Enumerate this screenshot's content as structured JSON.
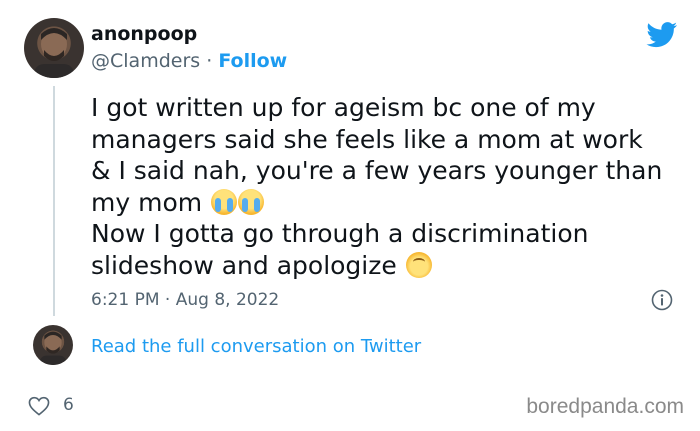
{
  "author": {
    "display_name": "anonpoop",
    "handle": "@Clamders",
    "separator": "·",
    "follow_label": "Follow"
  },
  "tweet": {
    "lines": [
      "I got written up for ageism bc one of my",
      "managers said she feels like a mom at work",
      "& I said nah, you're a few years younger than",
      "my mom",
      "Now I gotta go through a discrimination",
      "slideshow and apologize"
    ],
    "emojis": [
      "loudly-crying-face",
      "loudly-crying-face",
      "upside-down-face"
    ],
    "time": "6:21 PM",
    "date_separator": "·",
    "date": "Aug 8, 2022"
  },
  "conversation_link": "Read the full conversation on Twitter",
  "engagement": {
    "likes": "6"
  },
  "icons": {
    "brand": "twitter-bird-icon",
    "info": "info-icon",
    "like": "heart-icon"
  },
  "colors": {
    "twitter_blue": "#1d9bf0",
    "text_primary": "#0f1419",
    "text_secondary": "#536471"
  },
  "watermark": "boredpanda.com"
}
